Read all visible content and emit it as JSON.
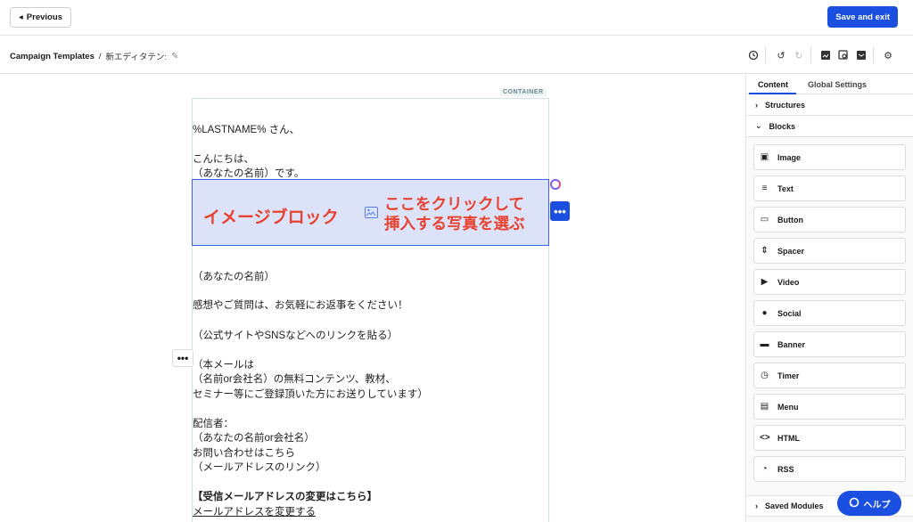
{
  "topbar": {
    "previous_label": "Previous",
    "save_label": "Save and exit"
  },
  "breadcrumb": {
    "root": "Campaign Templates",
    "separator": "/",
    "current": "新エディタテン:"
  },
  "toolbar": {
    "icons": [
      "history-icon",
      "undo-icon",
      "redo-icon",
      "preview-desktop-icon",
      "preview-search-icon",
      "send-test-icon",
      "settings-gear-icon"
    ]
  },
  "canvas": {
    "container_tag": "CONTAINER",
    "lines": {
      "greeting": "%LASTNAME% さん、",
      "hello": "こんにちは、",
      "intro": "（あなたの名前）です。",
      "sign_name": "（あなたの名前）",
      "feedback": "感想やご質問は、お気軽にお返事をください！",
      "links": "（公式サイトやSNSなどへのリンクを貼る）",
      "note1": "（本メールは",
      "note2": "（名前or会社名）の無料コンテンツ、教材、",
      "note3": "セミナー等にご登録頂いた方にお送りしています）",
      "sender_label": "配信者：",
      "sender_name": "（あなたの名前or会社名）",
      "contact": "お問い合わせはこちら",
      "contact_link": "（メールアドレスのリンク）",
      "change_heading": "【受信メールアドレスの変更はこちら】",
      "change_link": "メールアドレスを変更する"
    },
    "image_block": {
      "label": "イメージブロック",
      "note_line1": "ここをクリックして",
      "note_line2": "挿入する写真を選ぶ"
    }
  },
  "panel": {
    "tabs": [
      "Content",
      "Global Settings"
    ],
    "sections": {
      "structures": "Structures",
      "blocks": "Blocks",
      "saved": "Saved Modules"
    },
    "blocks": [
      {
        "label": "Image",
        "icon": "image-icon"
      },
      {
        "label": "Text",
        "icon": "text-icon"
      },
      {
        "label": "Button",
        "icon": "button-icon"
      },
      {
        "label": "Spacer",
        "icon": "spacer-icon"
      },
      {
        "label": "Video",
        "icon": "video-icon"
      },
      {
        "label": "Social",
        "icon": "social-icon"
      },
      {
        "label": "Banner",
        "icon": "banner-icon"
      },
      {
        "label": "Timer",
        "icon": "timer-icon"
      },
      {
        "label": "Menu",
        "icon": "menu-icon"
      },
      {
        "label": "HTML",
        "icon": "html-icon"
      },
      {
        "label": "RSS",
        "icon": "rss-icon"
      }
    ]
  },
  "help": {
    "label": "ヘルプ"
  },
  "colors": {
    "accent": "#1a4fe0",
    "annotation": "#e8412f",
    "selection": "#dce3f9"
  }
}
